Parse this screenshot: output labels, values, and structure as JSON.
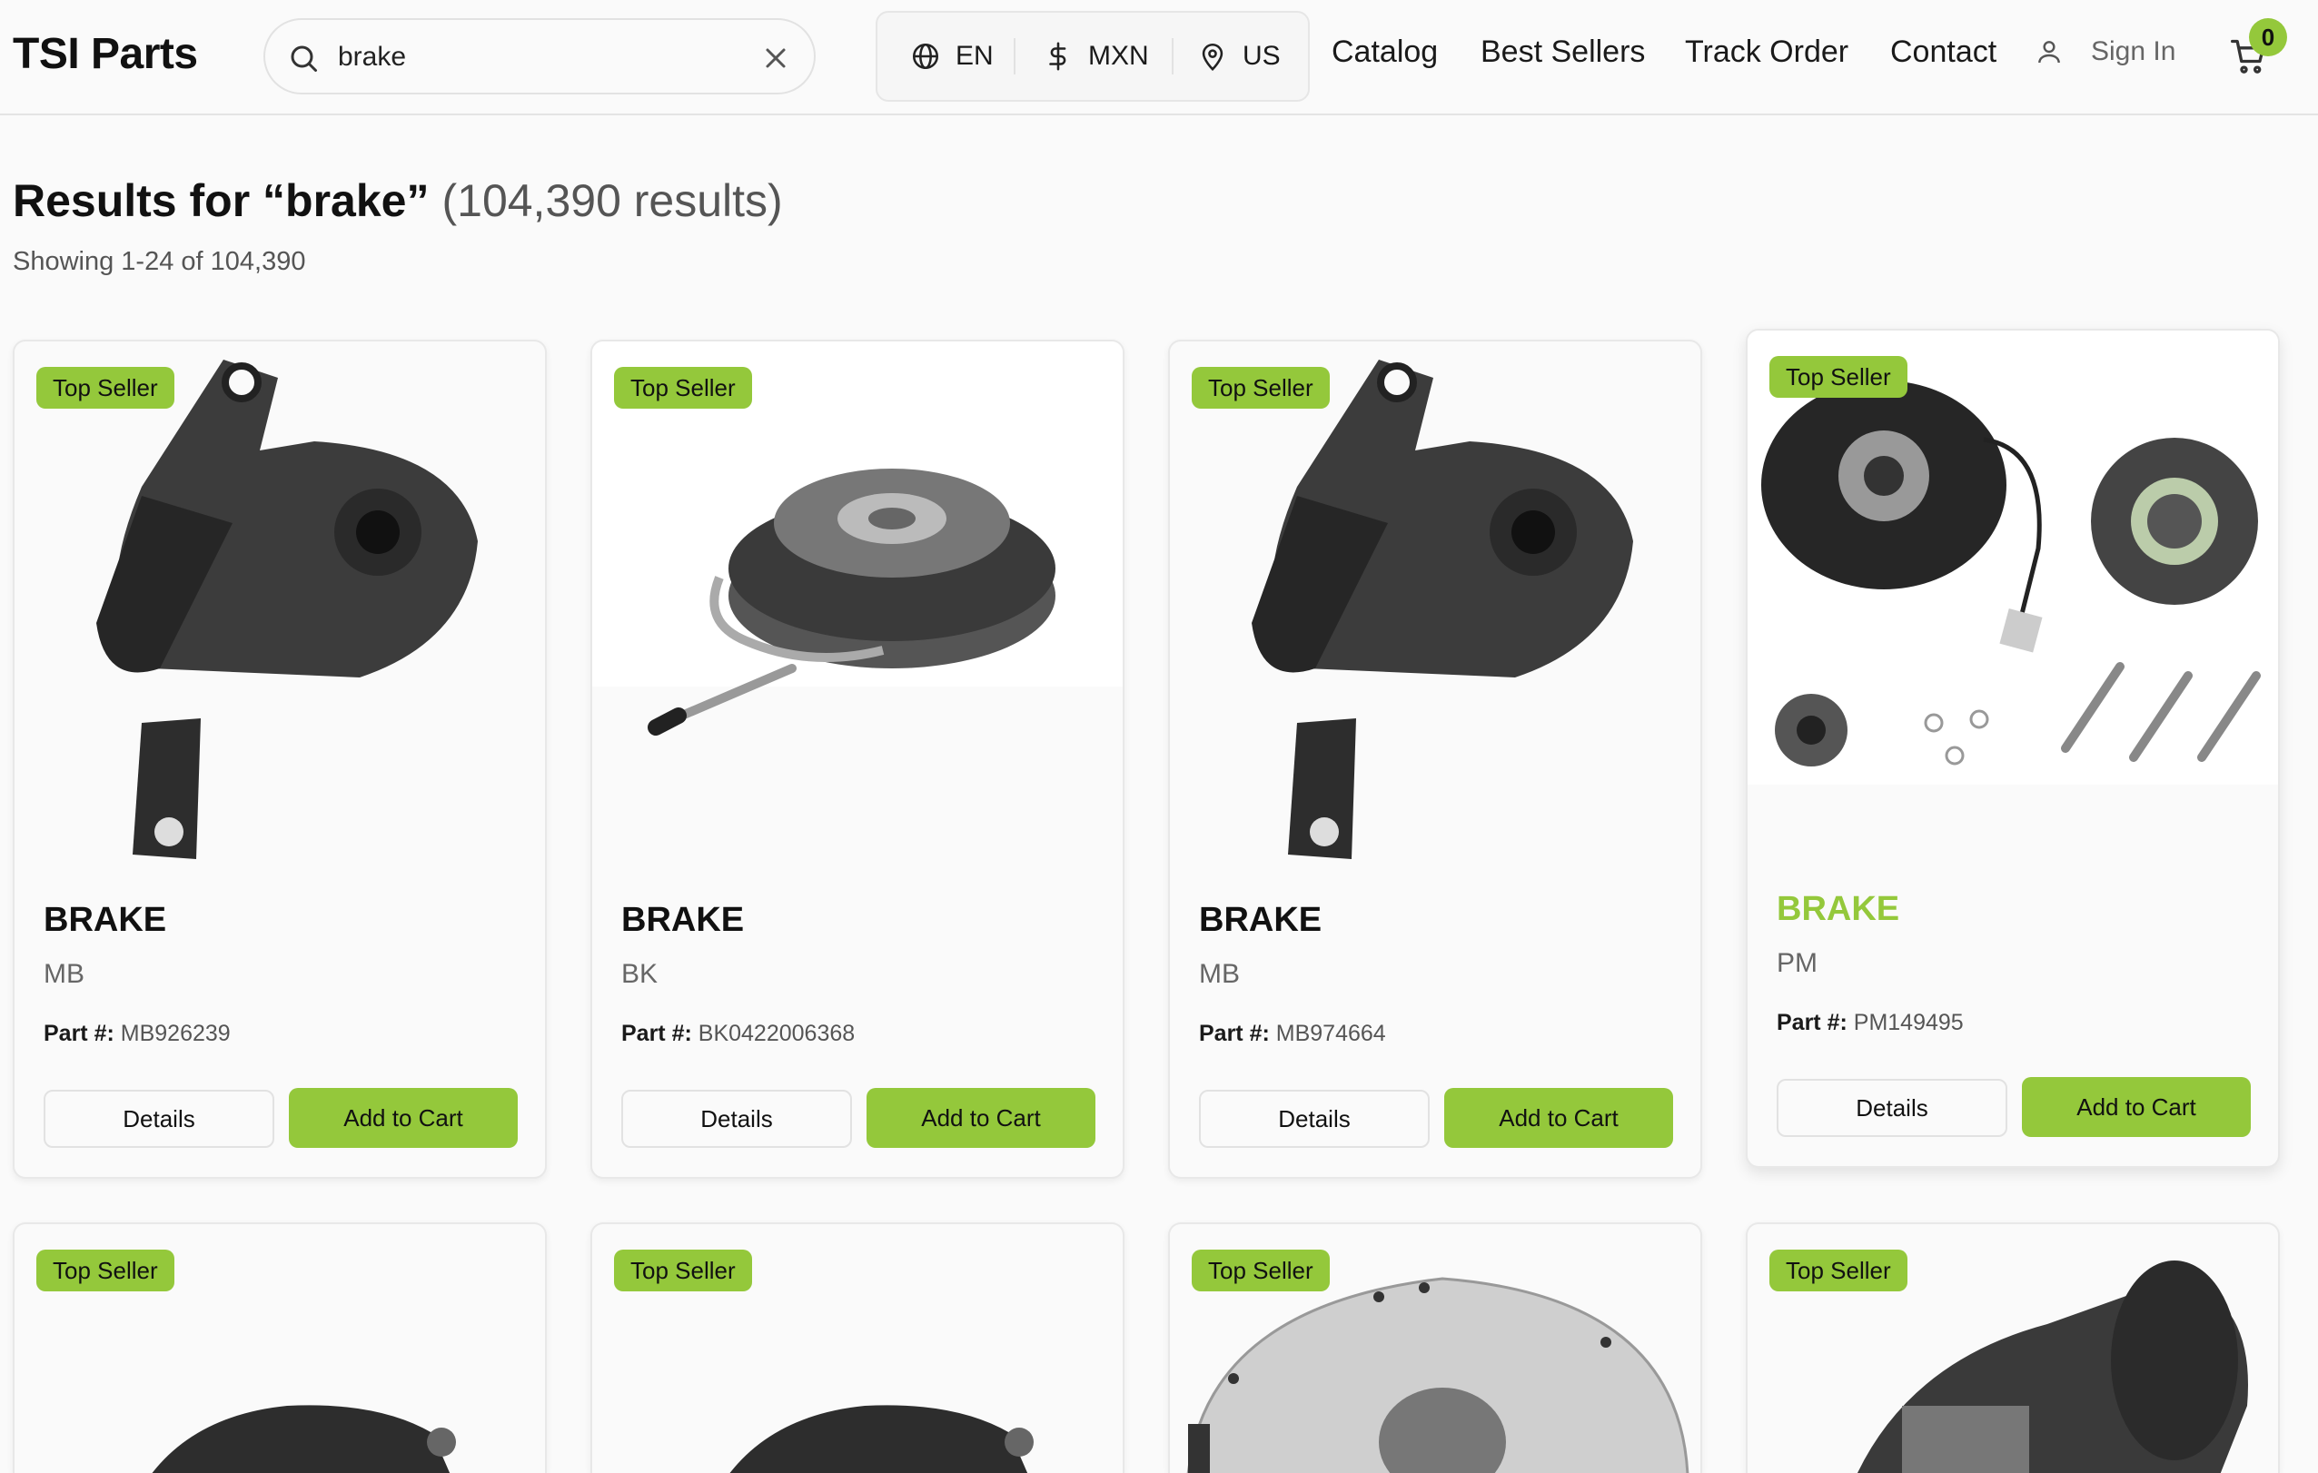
{
  "header": {
    "logo": "TSI Parts",
    "search": {
      "value": "brake",
      "placeholder": ""
    },
    "locale": {
      "language": "EN",
      "currency": "MXN",
      "region": "US"
    },
    "nav": [
      "Catalog",
      "Best Sellers",
      "Track Order",
      "Contact"
    ],
    "sign_in": "Sign In",
    "cart_count": "0"
  },
  "results": {
    "title": "Results for “brake”",
    "count": "(104,390 results)",
    "showing": "Showing 1-24 of 104,390"
  },
  "labels": {
    "part_prefix": "Part #:",
    "details": "Details",
    "add_to_cart": "Add to Cart"
  },
  "products": [
    {
      "badge": "Top Seller",
      "title": "BRAKE",
      "brand": "MB",
      "part": "MB926239"
    },
    {
      "badge": "Top Seller",
      "title": "BRAKE",
      "brand": "BK",
      "part": "BK0422006368"
    },
    {
      "badge": "Top Seller",
      "title": "BRAKE",
      "brand": "MB",
      "part": "MB974664"
    },
    {
      "badge": "Top Seller",
      "title": "BRAKE",
      "brand": "PM",
      "part": "PM149495"
    },
    {
      "badge": "Top Seller"
    },
    {
      "badge": "Top Seller"
    },
    {
      "badge": "Top Seller"
    },
    {
      "badge": "Top Seller"
    }
  ],
  "colors": {
    "accent": "#94c83b",
    "text": "#111111",
    "muted": "#666666",
    "border": "#e4e4e4"
  }
}
